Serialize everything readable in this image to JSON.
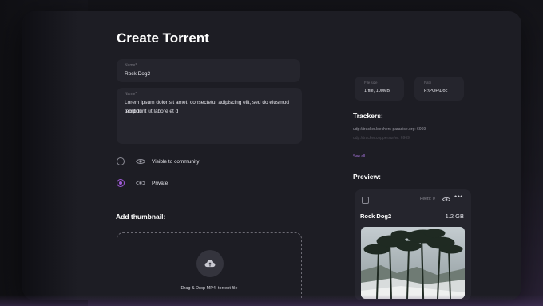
{
  "page": {
    "title": "Create Torrent"
  },
  "form": {
    "name_label": "Name*",
    "name_value": "Rock Dog2",
    "desc_label": "Name*",
    "desc_value_line1": "Lorem ipsum dolor sit amet, consectetur adipiscing elit, sed do eiusmod tempor",
    "desc_value_line2": "incididunt ut labore et d"
  },
  "visibility": {
    "options": [
      {
        "label": "Visible to community",
        "checked": false
      },
      {
        "label": "Private",
        "checked": true
      }
    ]
  },
  "thumbnail": {
    "heading": "Add thumbnail:",
    "drop_text": "Drag & Drop MP4, torrent file"
  },
  "stats": {
    "size_label": "File size",
    "size_value": "1 file, 100MB",
    "path_label": "Path",
    "path_value": "F:\\POP\\Doc"
  },
  "trackers": {
    "heading": "Trackers:",
    "items": [
      "udp://tracker.leechers-paradise.org: 6969",
      "udp://tracker.coppersurfer: 6969"
    ],
    "see_all": "See all"
  },
  "preview": {
    "heading": "Preview:",
    "peers": "Peers: 0",
    "more": "•••",
    "name": "Rock Dog2",
    "size": "1.2 GB"
  },
  "colors": {
    "accent": "#a15bd9",
    "link": "#b17ae8",
    "window_bg": "#1d1d24",
    "field_bg": "#25252d"
  },
  "icons": [
    "eye-icon",
    "upload-cloud-icon",
    "more-icon",
    "checkbox-icon"
  ]
}
